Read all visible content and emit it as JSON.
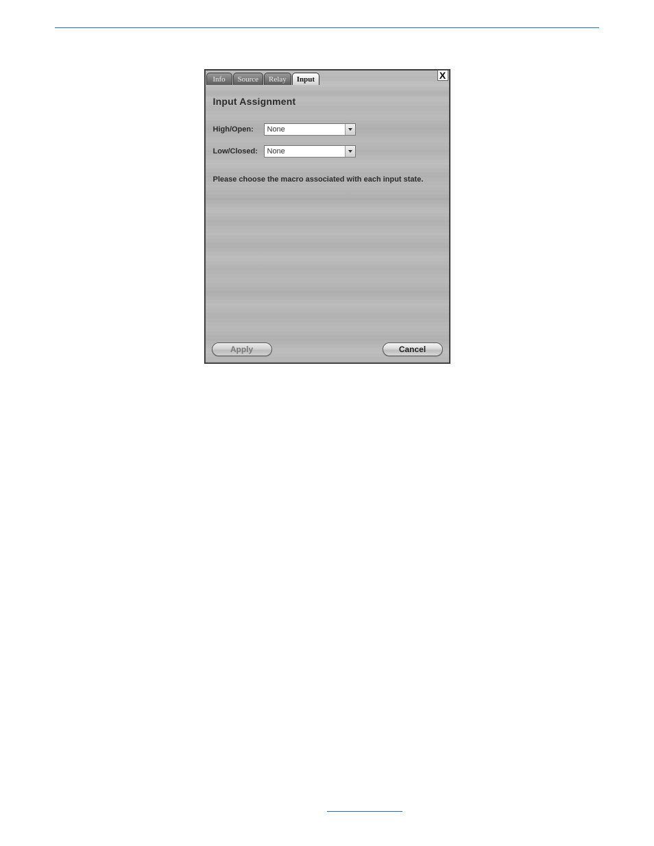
{
  "tabs": {
    "info": "Info",
    "source": "Source",
    "relay": "Relay",
    "input": "Input"
  },
  "close": "X",
  "section_title": "Input Assignment",
  "rows": {
    "high_open": {
      "label": "High/Open:",
      "value": "None"
    },
    "low_closed": {
      "label": "Low/Closed:",
      "value": "None"
    }
  },
  "hint": "Please choose the macro associated with each input state.",
  "buttons": {
    "apply": "Apply",
    "cancel": "Cancel"
  }
}
